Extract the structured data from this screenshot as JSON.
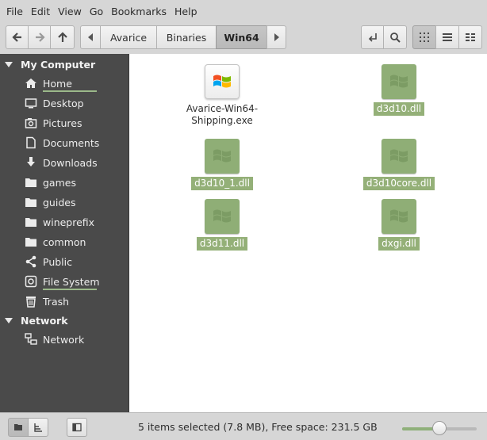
{
  "menubar": {
    "items": [
      "File",
      "Edit",
      "View",
      "Go",
      "Bookmarks",
      "Help"
    ]
  },
  "toolbar": {
    "breadcrumbs": [
      "Avarice",
      "Binaries",
      "Win64"
    ],
    "icons": [
      "back-icon",
      "forward-icon",
      "up-icon",
      "toggle-location-icon",
      "search-icon",
      "icon-view-icon",
      "list-view-icon",
      "compact-view-icon"
    ]
  },
  "sidebar": {
    "sections": [
      {
        "title": "My Computer"
      },
      {
        "title": "Network"
      }
    ],
    "items": [
      {
        "label": "Home",
        "icon": "home-icon",
        "usage": 0.6
      },
      {
        "label": "Desktop",
        "icon": "desktop-icon"
      },
      {
        "label": "Pictures",
        "icon": "camera-icon"
      },
      {
        "label": "Documents",
        "icon": "document-icon"
      },
      {
        "label": "Downloads",
        "icon": "download-icon"
      },
      {
        "label": "games",
        "icon": "folder-icon"
      },
      {
        "label": "guides",
        "icon": "folder-icon"
      },
      {
        "label": "wineprefix",
        "icon": "folder-icon"
      },
      {
        "label": "common",
        "icon": "folder-icon"
      },
      {
        "label": "Public",
        "icon": "share-icon"
      },
      {
        "label": "File System",
        "icon": "drive-icon",
        "usage": 0.95
      },
      {
        "label": "Trash",
        "icon": "trash-icon"
      },
      {
        "label": "Network",
        "icon": "network-icon"
      }
    ]
  },
  "files": [
    {
      "name": "Avarice-Win64-Shipping.exe",
      "type": "exe",
      "selected": false
    },
    {
      "name": "d3d10.dll",
      "type": "dll",
      "selected": true
    },
    {
      "name": "d3d10_1.dll",
      "type": "dll",
      "selected": true
    },
    {
      "name": "d3d10core.dll",
      "type": "dll",
      "selected": true
    },
    {
      "name": "d3d11.dll",
      "type": "dll",
      "selected": true
    },
    {
      "name": "dxgi.dll",
      "type": "dll",
      "selected": true
    }
  ],
  "status": {
    "text": "5 items selected (7.8 MB), Free space: 231.5 GB",
    "zoom_level": 0.5
  },
  "colors": {
    "selection": "#94b078",
    "accent": "#8fb07a",
    "sidebar_bg": "#4a4a4a"
  }
}
